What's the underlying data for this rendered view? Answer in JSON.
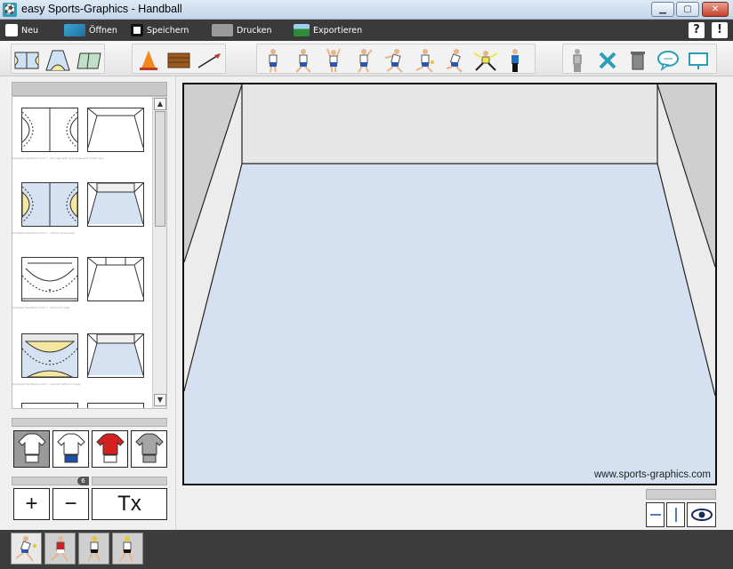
{
  "window": {
    "title": "easy Sports-Graphics - Handball"
  },
  "menu": {
    "items": [
      {
        "label": "Neu",
        "icon": "new-document-icon"
      },
      {
        "label": "Öffnen",
        "icon": "open-folder-icon"
      },
      {
        "label": "Speichern",
        "icon": "save-icon"
      },
      {
        "label": "Drucken",
        "icon": "printer-icon"
      },
      {
        "label": "Exportieren",
        "icon": "export-image-icon"
      }
    ],
    "help_label": "?",
    "info_label": "!"
  },
  "toolbar": {
    "court_views": [
      "court-top-view-icon",
      "court-perspective-icon",
      "court-side-view-icon"
    ],
    "equipment": [
      "cone-icon",
      "bench-icon",
      "arrow-tool-icon"
    ],
    "players": [
      "player-standing-icon",
      "player-running-icon",
      "player-jumping-icon",
      "player-throwing-icon",
      "player-passing-icon",
      "player-dribbling-icon",
      "player-sprinting-icon",
      "goalkeeper-icon",
      "referee-icon"
    ],
    "actions": [
      "player-properties-icon",
      "delete-icon",
      "trash-icon",
      "speech-bubble-icon",
      "presentation-icon"
    ]
  },
  "templates": {
    "captions": [
      "template handball court 1 - top view with goal areas and center line",
      "template handball court 2 - colored goal areas",
      "template handball court 3 - half court view",
      "template handball court 4 - colored half court view"
    ]
  },
  "shirts": [
    "white-shirt-icon",
    "blue-shorts-shirt-icon",
    "red-shirt-icon",
    "grey-shirt-icon"
  ],
  "size_controls": {
    "size_value": "6",
    "plus_label": "+",
    "minus_label": "−",
    "text_label": "Tx"
  },
  "canvas": {
    "watermark": "www.sports-graphics.com",
    "colors": {
      "floor": "#d5e1f1",
      "wall": "#e6e6e6",
      "side_wall": "#cfcfcf"
    }
  },
  "view_controls": [
    "horizontal-line-icon",
    "vertical-line-icon",
    "eye-icon"
  ],
  "animation_frames": [
    {
      "name": "frame-1",
      "selected": true
    },
    {
      "name": "frame-2",
      "selected": false
    },
    {
      "name": "frame-3",
      "selected": false
    },
    {
      "name": "frame-4",
      "selected": false
    }
  ]
}
